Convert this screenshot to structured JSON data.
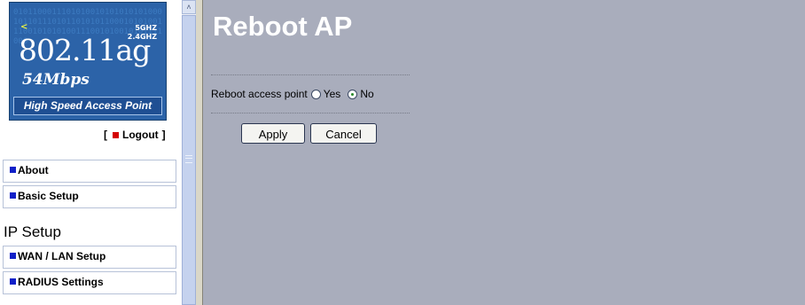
{
  "logo": {
    "binary": "010110001110101001010101010100010110111010110101011000101010011100101010100111001010010101111000",
    "freq_5": "5GHZ",
    "freq_24": "2.4GHZ",
    "standard": "802.11ag",
    "rate": "54Mbps",
    "tagline": "High Speed Access Point",
    "chevron": "<"
  },
  "logout": {
    "open": "[",
    "label": "Logout",
    "close": "]"
  },
  "nav": {
    "about": "About",
    "basic_setup": "Basic Setup",
    "section_ip": "IP Setup",
    "wan_lan": "WAN / LAN Setup",
    "radius": "RADIUS Settings"
  },
  "scrollbar": {
    "up_arrow": "˄"
  },
  "main": {
    "title": "Reboot AP",
    "reboot_label": "Reboot access point",
    "option_yes": "Yes",
    "option_no": "No",
    "selected": "No",
    "apply": "Apply",
    "cancel": "Cancel"
  },
  "colors": {
    "main_bg": "#a9adbc",
    "logo_bg": "#2c63a8",
    "nav_square": "#1020c8",
    "logout_square": "#d40000"
  }
}
